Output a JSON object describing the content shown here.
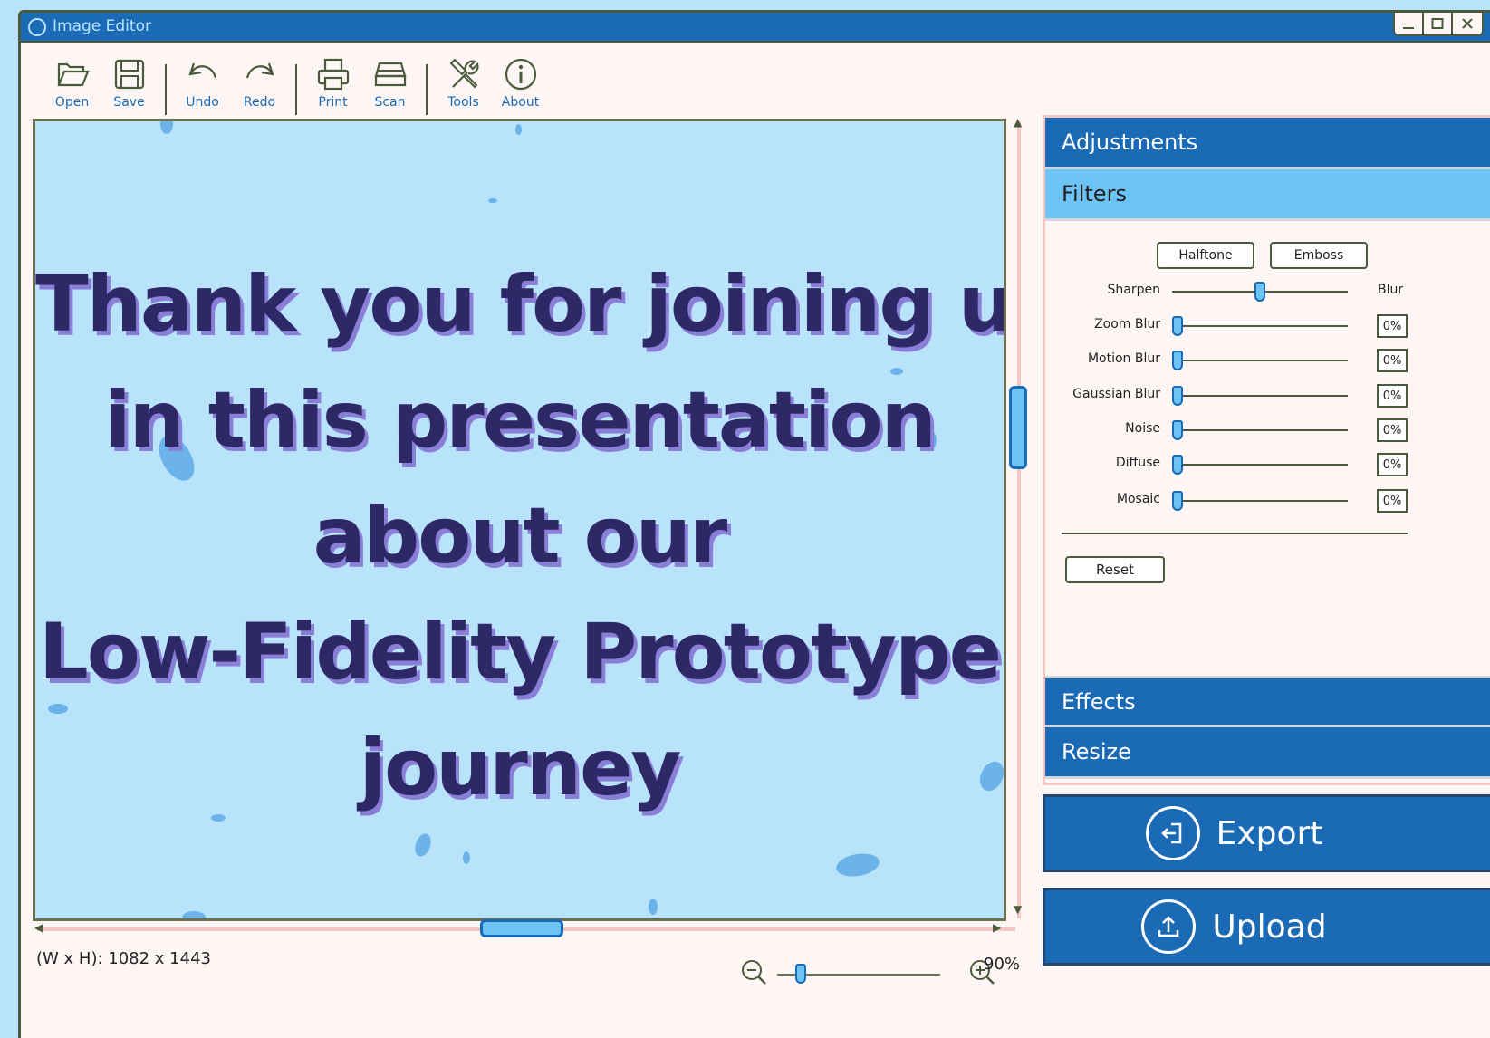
{
  "window": {
    "title": "Image Editor"
  },
  "toolbar": {
    "items": [
      {
        "label": "Open",
        "icon": "folder-open-icon"
      },
      {
        "label": "Save",
        "icon": "floppy-icon"
      },
      {
        "label": "Undo",
        "icon": "undo-icon"
      },
      {
        "label": "Redo",
        "icon": "redo-icon"
      },
      {
        "label": "Print",
        "icon": "printer-icon"
      },
      {
        "label": "Scan",
        "icon": "scanner-icon"
      },
      {
        "label": "Tools",
        "icon": "tools-icon"
      },
      {
        "label": "About",
        "icon": "info-icon"
      }
    ]
  },
  "canvas": {
    "lines": [
      "Thank you for joining us",
      "in this presentation",
      "about our",
      "Low-Fidelity Prototype",
      "journey"
    ]
  },
  "status": {
    "dimensions": "(W x H): 1082 x 1443",
    "zoom": "90%",
    "zoom_level": 0.12
  },
  "panel": {
    "adjustments": "Adjustments",
    "filters": "Filters",
    "effects": "Effects",
    "resize": "Resize",
    "chips": [
      "Halftone",
      "Emboss"
    ],
    "sharpen": {
      "label": "Sharpen",
      "right_label": "Blur",
      "level": 0.5
    },
    "sliders": [
      {
        "label": "Zoom Blur",
        "value": "0%"
      },
      {
        "label": "Motion Blur",
        "value": "0%"
      },
      {
        "label": "Gaussian Blur",
        "value": "0%"
      },
      {
        "label": "Noise",
        "value": "0%"
      },
      {
        "label": "Diffuse",
        "value": "0%"
      },
      {
        "label": "Mosaic",
        "value": "0%"
      }
    ],
    "reset": "Reset"
  },
  "actions": {
    "export": "Export",
    "upload": "Upload"
  },
  "colors": {
    "primary": "#1a6ab5",
    "accent": "#6cc3f5",
    "canvas_bg": "#b8e3fb",
    "text_dark": "#2e2866"
  }
}
